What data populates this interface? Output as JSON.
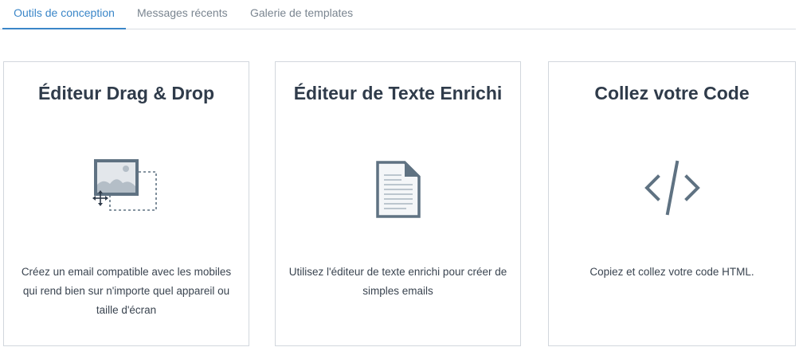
{
  "tabs": [
    {
      "label": "Outils de conception",
      "active": true
    },
    {
      "label": "Messages récents",
      "active": false
    },
    {
      "label": "Galerie de templates",
      "active": false
    }
  ],
  "cards": [
    {
      "title": "Éditeur Drag & Drop",
      "icon": "drag-drop-image-icon",
      "description": "Créez un email compatible avec les mobiles qui rend bien sur n'importe quel appareil ou taille d'écran"
    },
    {
      "title": "Éditeur de Texte Enrichi",
      "icon": "document-icon",
      "description": "Utilisez l'éditeur de texte enrichi pour créer de simples emails"
    },
    {
      "title": "Collez votre Code",
      "icon": "code-icon",
      "description": "Copiez et collez votre code HTML."
    }
  ],
  "colors": {
    "accent": "#3a86c8",
    "icon": "#5f7282",
    "border": "#d2d7dd"
  }
}
